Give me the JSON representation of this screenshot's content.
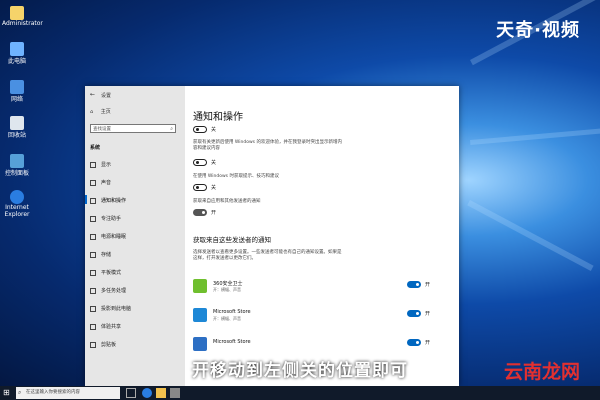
{
  "watermark_top": "天奇·视频",
  "watermark_bottom": "云南龙网",
  "subtitle": "开移动到左侧关的位置即可",
  "desktop_icons": [
    {
      "label": "Administrator"
    },
    {
      "label": "此电脑"
    },
    {
      "label": "网络"
    },
    {
      "label": "回收站"
    },
    {
      "label": "控制面板"
    },
    {
      "label": "Internet Explorer"
    }
  ],
  "window": {
    "title": "设置",
    "home": "主页",
    "search_placeholder": "查找设置",
    "section": "系统",
    "nav": [
      {
        "label": "显示"
      },
      {
        "label": "声音"
      },
      {
        "label": "通知和操作"
      },
      {
        "label": "专注助手"
      },
      {
        "label": "电源和睡眠"
      },
      {
        "label": "存储"
      },
      {
        "label": "平板模式"
      },
      {
        "label": "多任务处理"
      },
      {
        "label": "投影到此电脑"
      },
      {
        "label": "体验共享"
      },
      {
        "label": "剪贴板"
      }
    ],
    "page_title": "通知和操作",
    "settings": [
      {
        "desc": "",
        "state": "关"
      },
      {
        "desc": "获取有关更新后使用 Windows 的欢迎体验，并在我登录时突出显示新增内容和建议内容",
        "state": "关"
      },
      {
        "desc": "在使用 Windows 时获取提示、技巧和建议",
        "state": "关"
      },
      {
        "desc": "获取来自应用和其他发送者的通知",
        "state": "开"
      }
    ],
    "senders_title": "获取来自这些发送者的通知",
    "senders_desc": "选择发送者以查看更多设置。一些发送者可能也有自己的通知设置。如果是这样，打开发送者以更改它们。",
    "apps": [
      {
        "name": "360安全卫士",
        "sub": "开：横幅、声音",
        "state": "开"
      },
      {
        "name": "Microsoft Store",
        "sub": "开：横幅、声音",
        "state": "开"
      },
      {
        "name": "Microsoft Store",
        "sub": "",
        "state": "开"
      }
    ]
  },
  "taskbar": {
    "search_placeholder": "在这里输入你要搜索的内容"
  },
  "colors": {
    "accent": "#0067c0",
    "subtitle_text": "#ffffff",
    "watermark_bottom": "#e23030"
  }
}
